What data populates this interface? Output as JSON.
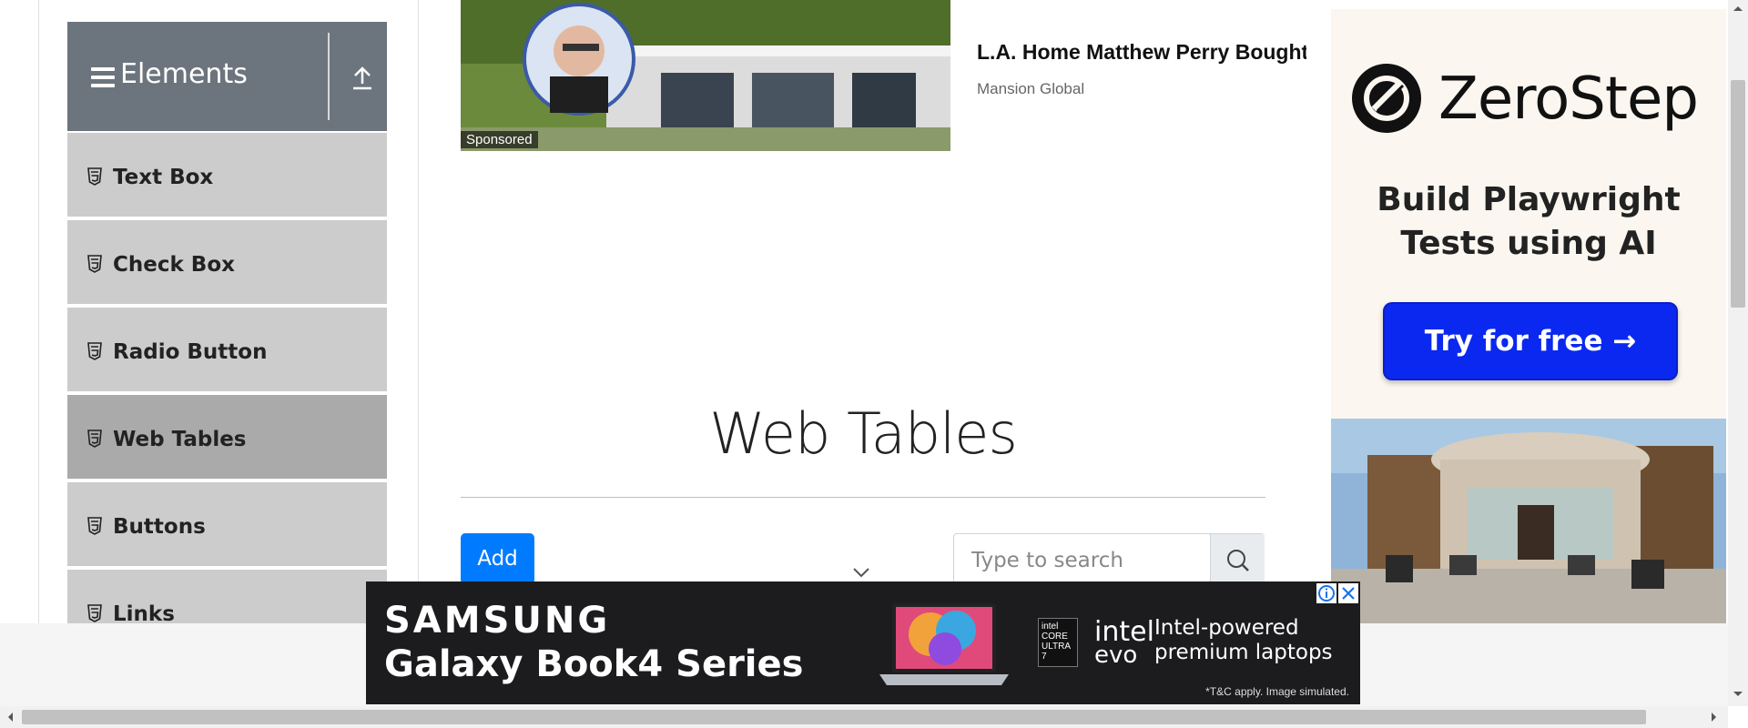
{
  "sidebar": {
    "header_label": "Elements",
    "items": [
      {
        "label": "Text Box"
      },
      {
        "label": "Check Box"
      },
      {
        "label": "Radio Button"
      },
      {
        "label": "Web Tables"
      },
      {
        "label": "Buttons"
      },
      {
        "label": "Links"
      }
    ],
    "active_item": "Web Tables"
  },
  "top_ad": {
    "sponsored": "Sponsored",
    "headline": "L.A. Home Matthew Perry Bought",
    "source": "Mansion Global"
  },
  "main": {
    "title": "Web Tables",
    "add_label": "Add",
    "search_placeholder": "Type to search"
  },
  "right_ad": {
    "brand": "ZeroStep",
    "tagline_line1": "Build Playwright",
    "tagline_line2": "Tests using AI",
    "cta": "Try for free →"
  },
  "bottom_ad": {
    "brand": "SAMSUNG",
    "product": "Galaxy Book4 Series",
    "badge_text": "intel CORE ULTRA 7",
    "intel_word": "intel",
    "evo_word": "evo",
    "claim_line1": "Intel-powered",
    "claim_line2": "premium laptops",
    "disclaimer": "*T&C apply. Image simulated."
  },
  "colors": {
    "sidebar_header": "#6c757d",
    "menu_item": "#cccccc",
    "menu_item_active": "#aaaaaa",
    "primary_button": "#007bff",
    "zerostep_cta": "#0a28f0"
  },
  "icons": {
    "menu": "hamburger-icon",
    "collapse": "upload-icon",
    "item": "html5-icon",
    "search": "search-icon",
    "dropdown": "chevron-down-icon"
  }
}
